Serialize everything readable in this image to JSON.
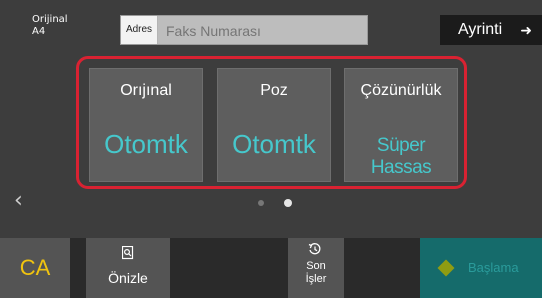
{
  "header": {
    "original_label": "Orijinal",
    "original_size": "A4",
    "address_tag": "Adres",
    "fax_placeholder": "Faks Numarası",
    "detail_label": "Ayrinti",
    "detail_arrow": "➜"
  },
  "settings": [
    {
      "label": "Orıjınal",
      "value": "Otomtk"
    },
    {
      "label": "Poz",
      "value": "Otomtk"
    },
    {
      "label": "Çözünürlük",
      "value": "Süper Hassas"
    }
  ],
  "pager": {
    "prev_icon": "‹",
    "current_page": 2,
    "total_pages": 2
  },
  "bottom": {
    "ca_label": "CA",
    "preview_label": "Önizle",
    "recent_label_line1": "Son",
    "recent_label_line2": "İşler",
    "start_label": "Başlama"
  },
  "colors": {
    "accent_red": "#d92232",
    "value_cyan": "#46c8cc",
    "ca_yellow": "#f1c40f",
    "start_teal": "#156b6b"
  }
}
